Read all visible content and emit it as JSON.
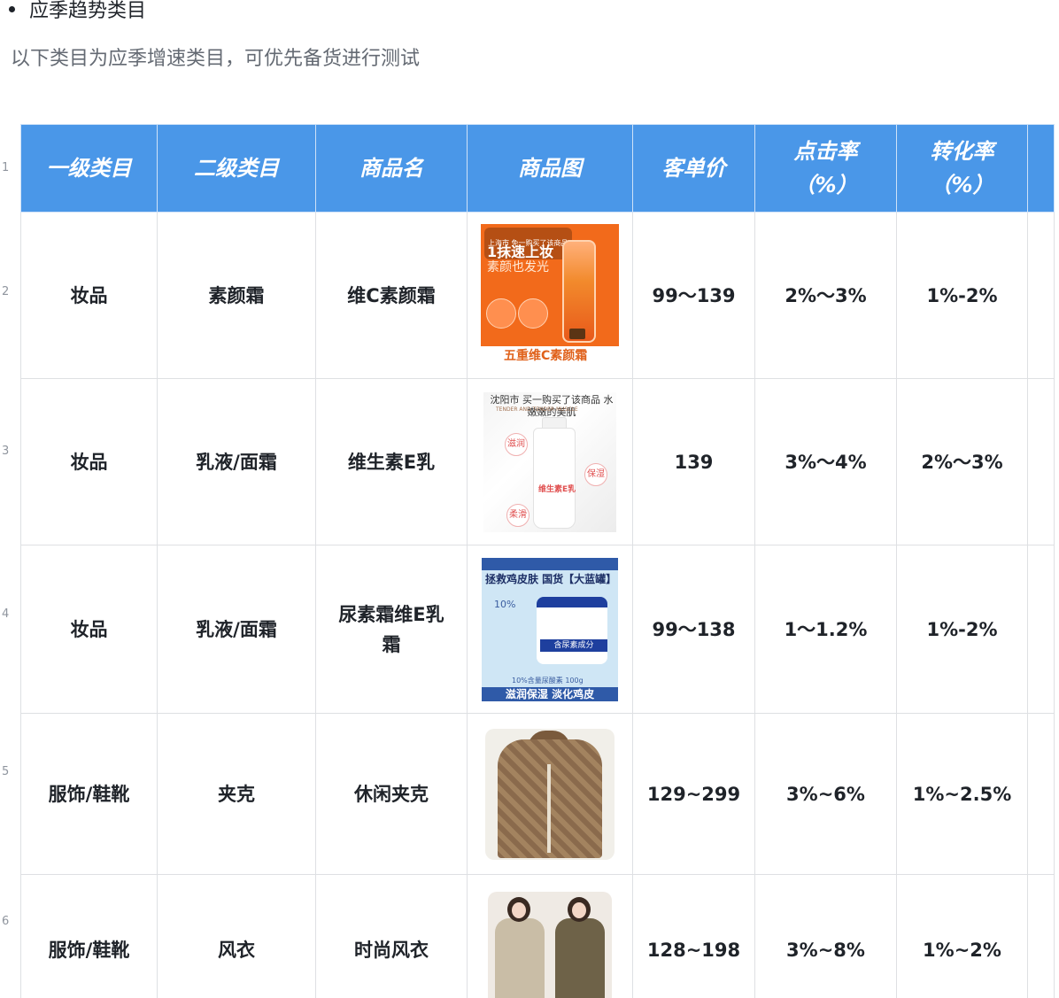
{
  "heading": {
    "bullet_text": "应季趋势类目",
    "subtitle": "以下类目为应季增速类目，可优先备货进行测试"
  },
  "row_numbers": [
    "1",
    "2",
    "3",
    "4",
    "5",
    "6"
  ],
  "table": {
    "headers": [
      "一级类目",
      "二级类目",
      "商品名",
      "商品图",
      "客单价",
      "点击率\n（%）",
      "转化率\n（%）"
    ],
    "header_lines": {
      "click_rate": [
        "点击率",
        "（%）"
      ],
      "conversion_rate": [
        "转化率",
        "（%）"
      ]
    },
    "rows": [
      {
        "cat1": "妆品",
        "cat2": "素颜霜",
        "name": "维C素颜霜",
        "price": "99～139",
        "ctr": "2%～3%",
        "cvr": "1%-2%"
      },
      {
        "cat1": "妆品",
        "cat2": "乳液/面霜",
        "name": "维生素E乳",
        "price": "139",
        "ctr": "3%～4%",
        "cvr": "2%～3%"
      },
      {
        "cat1": "妆品",
        "cat2": "乳液/面霜",
        "name": "尿素霜维E乳霜",
        "price": "99～138",
        "ctr": "1～1.2%",
        "cvr": "1%-2%"
      },
      {
        "cat1": "服饰/鞋靴",
        "cat2": "夹克",
        "name": "休闲夹克",
        "price": "129~299",
        "ctr": "3%~6%",
        "cvr": "1%~2.5%"
      },
      {
        "cat1": "服饰/鞋靴",
        "cat2": "风衣",
        "name": "时尚风衣",
        "price": "128~198",
        "ctr": "3%~8%",
        "cvr": "1%~2%"
      }
    ]
  },
  "product_images": {
    "img1": {
      "tag": "上海市 免一购买了该商品",
      "headline": "1抹速上妆",
      "sub": "素颜也发光",
      "caption": "五重维C素颜霜"
    },
    "img2": {
      "top": "沈阳市 买一购买了该商品 水嫩嫩的美肌",
      "sub": "TENDER AND TENDER MUSCLE",
      "label": "维生素E乳",
      "tag1": "滋润",
      "tag2": "保湿",
      "tag3": "柔滑"
    },
    "img3": {
      "top": "拯救鸡皮肤 国货【大蓝罐】",
      "pct": "10%",
      "jar": "含尿素成分",
      "under": "10%含量尿酸素 100g",
      "bottom": "滋润保湿 淡化鸡皮"
    }
  },
  "colors": {
    "header_bg": "#4a97e8",
    "header_text": "#ffffff",
    "border": "#dee0e3",
    "subtitle": "#646a73"
  }
}
